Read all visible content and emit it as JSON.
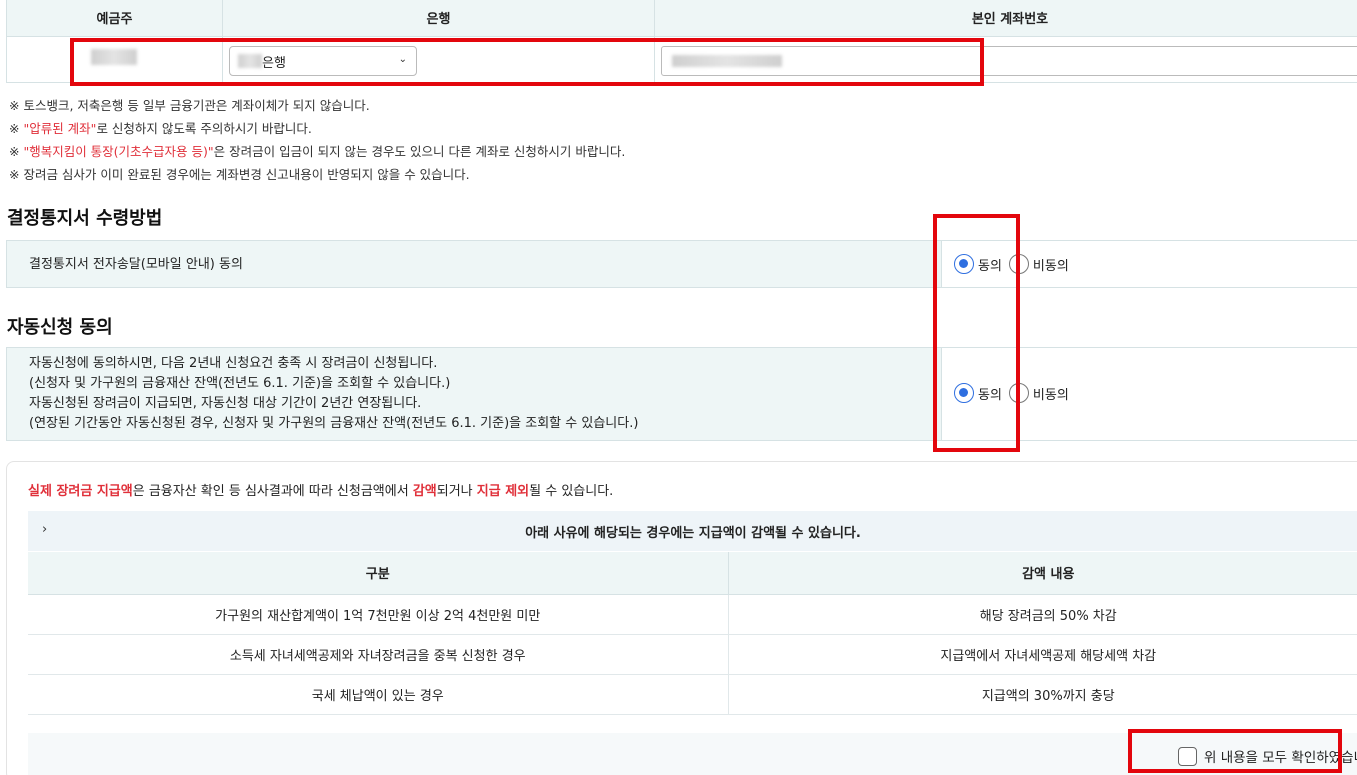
{
  "account": {
    "headers": [
      "예금주",
      "은행",
      "본인 계좌번호"
    ],
    "bank_suffix": "은행",
    "chevron": "chevron-down-icon"
  },
  "notes": {
    "n1": "※ 토스뱅크, 저축은행 등 일부 금융기관은 계좌이체가 되지 않습니다.",
    "n2_pre": "※ ",
    "n2_red": "\"압류된 계좌\"",
    "n2_post": "로 신청하지 않도록 주의하시기 바랍니다.",
    "n3_pre": "※ ",
    "n3_red": "\"행복지킴이 통장(기초수급자용 등)\"",
    "n3_post": "은 장려금이 입금이 되지 않는 경우도 있으니 다른 계좌로 신청하시기 바랍니다.",
    "n4": "※ 장려금 심사가 이미 완료된 경우에는 계좌변경 신고내용이 반영되지 않을 수 있습니다."
  },
  "decision": {
    "title": "결정통지서 수령방법",
    "text": "결정통지서 전자송달(모바일 안내) 동의",
    "agree": "동의",
    "disagree": "비동의"
  },
  "auto": {
    "title": "자동신청 동의",
    "lines": [
      "자동신청에 동의하시면, 다음 2년내 신청요건 충족 시 장려금이 신청됩니다.",
      "(신청자 및 가구원의 금융재산 잔액(전년도 6.1. 기준)을 조회할 수 있습니다.)",
      "자동신청된 장려금이 지급되면, 자동신청 대상 기간이 2년간 연장됩니다.",
      "(연장된 기간동안 자동신청된 경우, 신청자 및 가구원의 금융재산 잔액(전년도 6.1. 기준)을 조회할 수 있습니다.)"
    ],
    "agree": "동의",
    "disagree": "비동의"
  },
  "notice": {
    "lead_red1": "실제 장려금 지급액",
    "lead_mid1": "은 금융자산 확인 등 심사결과에 따라 신청금액에서 ",
    "lead_red2": "감액",
    "lead_mid2": "되거나 ",
    "lead_red3": "지급 제외",
    "lead_end": "될 수 있습니다.",
    "accordion_title": "아래 사유에 해당되는 경우에는 지급액이 감액될 수 있습니다.",
    "table_headers": [
      "구분",
      "감액 내용"
    ],
    "rows": [
      [
        "가구원의 재산합계액이 1억 7천만원 이상 2억 4천만원 미만",
        "해당 장려금의 50% 차감"
      ],
      [
        "소득세 자녀세액공제와 자녀장려금을 중복 신청한 경우",
        "지급액에서 자녀세액공제 해당세액 차감"
      ],
      [
        "국세 체납액이 있는 경우",
        "지급액의 30%까지 충당"
      ]
    ],
    "confirm": "위 내용을 모두 확인하였습니다"
  },
  "colors": {
    "highlight": "#e3060d",
    "accent": "#2f6fe0",
    "red_text": "#e0303a"
  }
}
